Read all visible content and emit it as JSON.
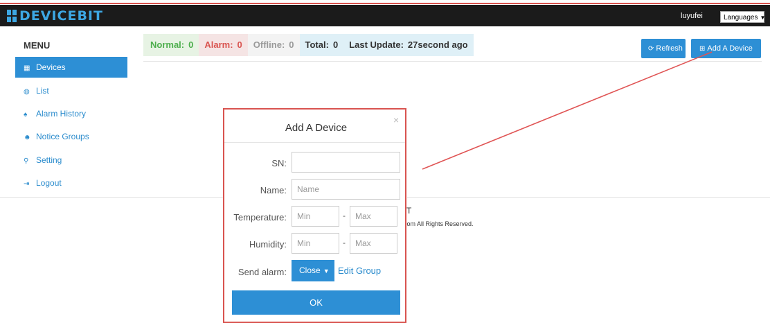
{
  "brand": {
    "name": "DEVICEBIT"
  },
  "header": {
    "username": "luyufei",
    "language_label": "Languages"
  },
  "sidebar": {
    "menu_title": "MENU",
    "items": [
      {
        "label": "Devices",
        "icon": "grid-icon",
        "active": true
      },
      {
        "label": "List",
        "icon": "dashboard-icon"
      },
      {
        "label": "Alarm History",
        "icon": "bell-icon"
      },
      {
        "label": "Notice Groups",
        "icon": "users-icon"
      },
      {
        "label": "Setting",
        "icon": "key-icon"
      },
      {
        "label": "Logout",
        "icon": "logout-icon"
      }
    ]
  },
  "status": {
    "normal_label": "Normal:",
    "normal_value": "0",
    "alarm_label": "Alarm:",
    "alarm_value": "0",
    "offline_label": "Offline:",
    "offline_value": "0",
    "total_label": "Total:",
    "total_value": "0",
    "update_label": "Last Update:",
    "update_value": "27second ago"
  },
  "toolbar": {
    "refresh_label": "Refresh",
    "add_label": "Add A Device"
  },
  "footer": {
    "line1": "T",
    "line2": "com All Rights Reserved."
  },
  "modal": {
    "title": "Add A Device",
    "close_symbol": "×",
    "sn_label": "SN:",
    "sn_value": "",
    "name_label": "Name:",
    "name_placeholder": "Name",
    "temperature_label": "Temperature:",
    "humidity_label": "Humidity:",
    "min_placeholder": "Min",
    "max_placeholder": "Max",
    "range_separator": "-",
    "send_alarm_label": "Send alarm:",
    "send_alarm_value": "Close",
    "edit_group_label": "Edit Group",
    "ok_label": "OK"
  },
  "colors": {
    "accent": "#2d8fd5",
    "annotation": "#d9534f",
    "normal": "#4cae4c",
    "alarm": "#d9534f"
  }
}
